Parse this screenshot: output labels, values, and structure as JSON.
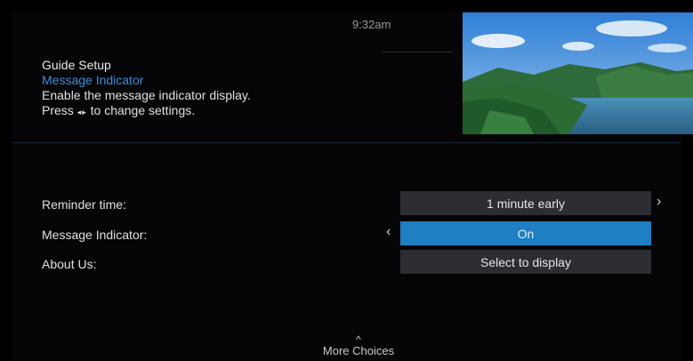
{
  "clock": "9:32am",
  "header": {
    "title": "Guide Setup",
    "subtitle": "Message Indicator",
    "description": "Enable the message indicator display.",
    "hint_prefix": "Press",
    "hint_glyph": "◂▸",
    "hint_suffix": "to change settings."
  },
  "settings": [
    {
      "label": "Reminder time:",
      "value": "1 minute early"
    },
    {
      "label": "Message Indicator:",
      "value": "On"
    },
    {
      "label": "About Us:",
      "value": "Select to display"
    }
  ],
  "chevrons": {
    "left": "‹",
    "right": "›"
  },
  "footer": {
    "up_arrow": "^",
    "label": "More Choices"
  },
  "colors": {
    "accent": "#1f7fc2",
    "subtitle": "#3b8ed6",
    "row_bg": "#2b2d33"
  },
  "icons": {
    "preview": "landscape-video-preview"
  }
}
